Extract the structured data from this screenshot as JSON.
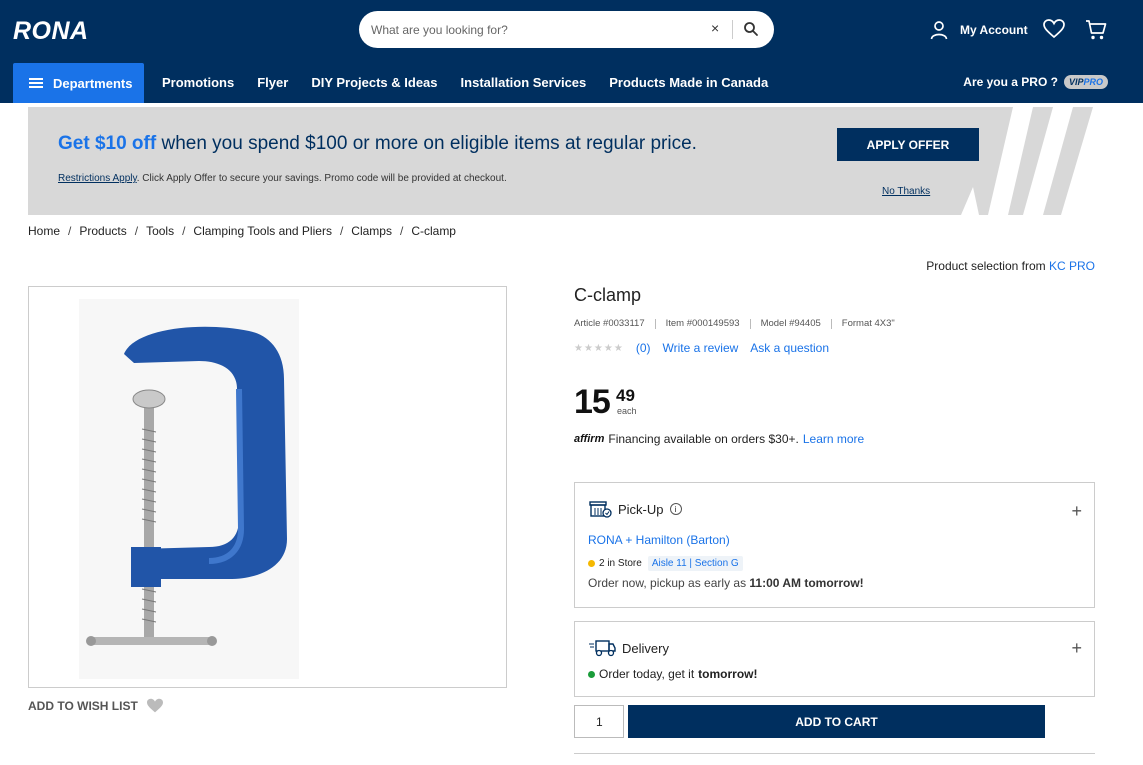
{
  "header": {
    "logo": "RONA",
    "search_placeholder": "What are you looking for?",
    "clear": "×",
    "account_label": "My Account"
  },
  "nav": {
    "departments": "Departments",
    "links": [
      "Promotions",
      "Flyer",
      "DIY Projects & Ideas",
      "Installation Services",
      "Products Made in Canada"
    ],
    "pro_label": "Are you a PRO ?",
    "vip_prefix": "VIP",
    "vip_suffix": "PRO"
  },
  "promo": {
    "highlight": "Get $10 off",
    "text": " when you spend $100 or more on eligible items at regular price.",
    "restrictions": "Restrictions Apply",
    "sub": ". Click Apply Offer to secure your savings. Promo code will be provided at checkout.",
    "apply": "APPLY OFFER",
    "no_thanks": "No Thanks"
  },
  "breadcrumb": [
    "Home",
    "Products",
    "Tools",
    "Clamping Tools and Pliers",
    "Clamps",
    "C-clamp"
  ],
  "product": {
    "selection_prefix": "Product selection from ",
    "brand": "KC PRO",
    "title": "C-clamp",
    "article": "Article #0033117",
    "item": "Item #000149593",
    "model": "Model #94405",
    "format": "Format 4X3\"",
    "stars": "★★★★★",
    "review_count": "(0)",
    "write_review": "Write a review",
    "ask_question": "Ask a question",
    "price_int": "15",
    "price_cents": "49",
    "price_unit": "each",
    "affirm": "affirm",
    "financing": "Financing available on orders $30+.",
    "learn_more": "Learn more",
    "add_to_wish_list": "ADD TO WISH LIST"
  },
  "pickup": {
    "title": "Pick-Up",
    "info": "i",
    "store": "RONA + Hamilton (Barton)",
    "stock": "2 in Store",
    "aisle": "Aisle  11 | Section G",
    "order_prefix": "Order now, pickup as early as ",
    "order_time": "11:00 AM tomorrow!",
    "plus": "+",
    "status_color": "#f5b800"
  },
  "delivery": {
    "title": "Delivery",
    "msg_prefix": "Order today, get it ",
    "msg_bold": "tomorrow!",
    "plus": "+",
    "status_color": "#1a9c3a"
  },
  "cart": {
    "quantity": "1",
    "add_to_cart": "ADD TO CART"
  },
  "colors": {
    "navy": "#002f5f",
    "blue": "#1a73e8"
  }
}
